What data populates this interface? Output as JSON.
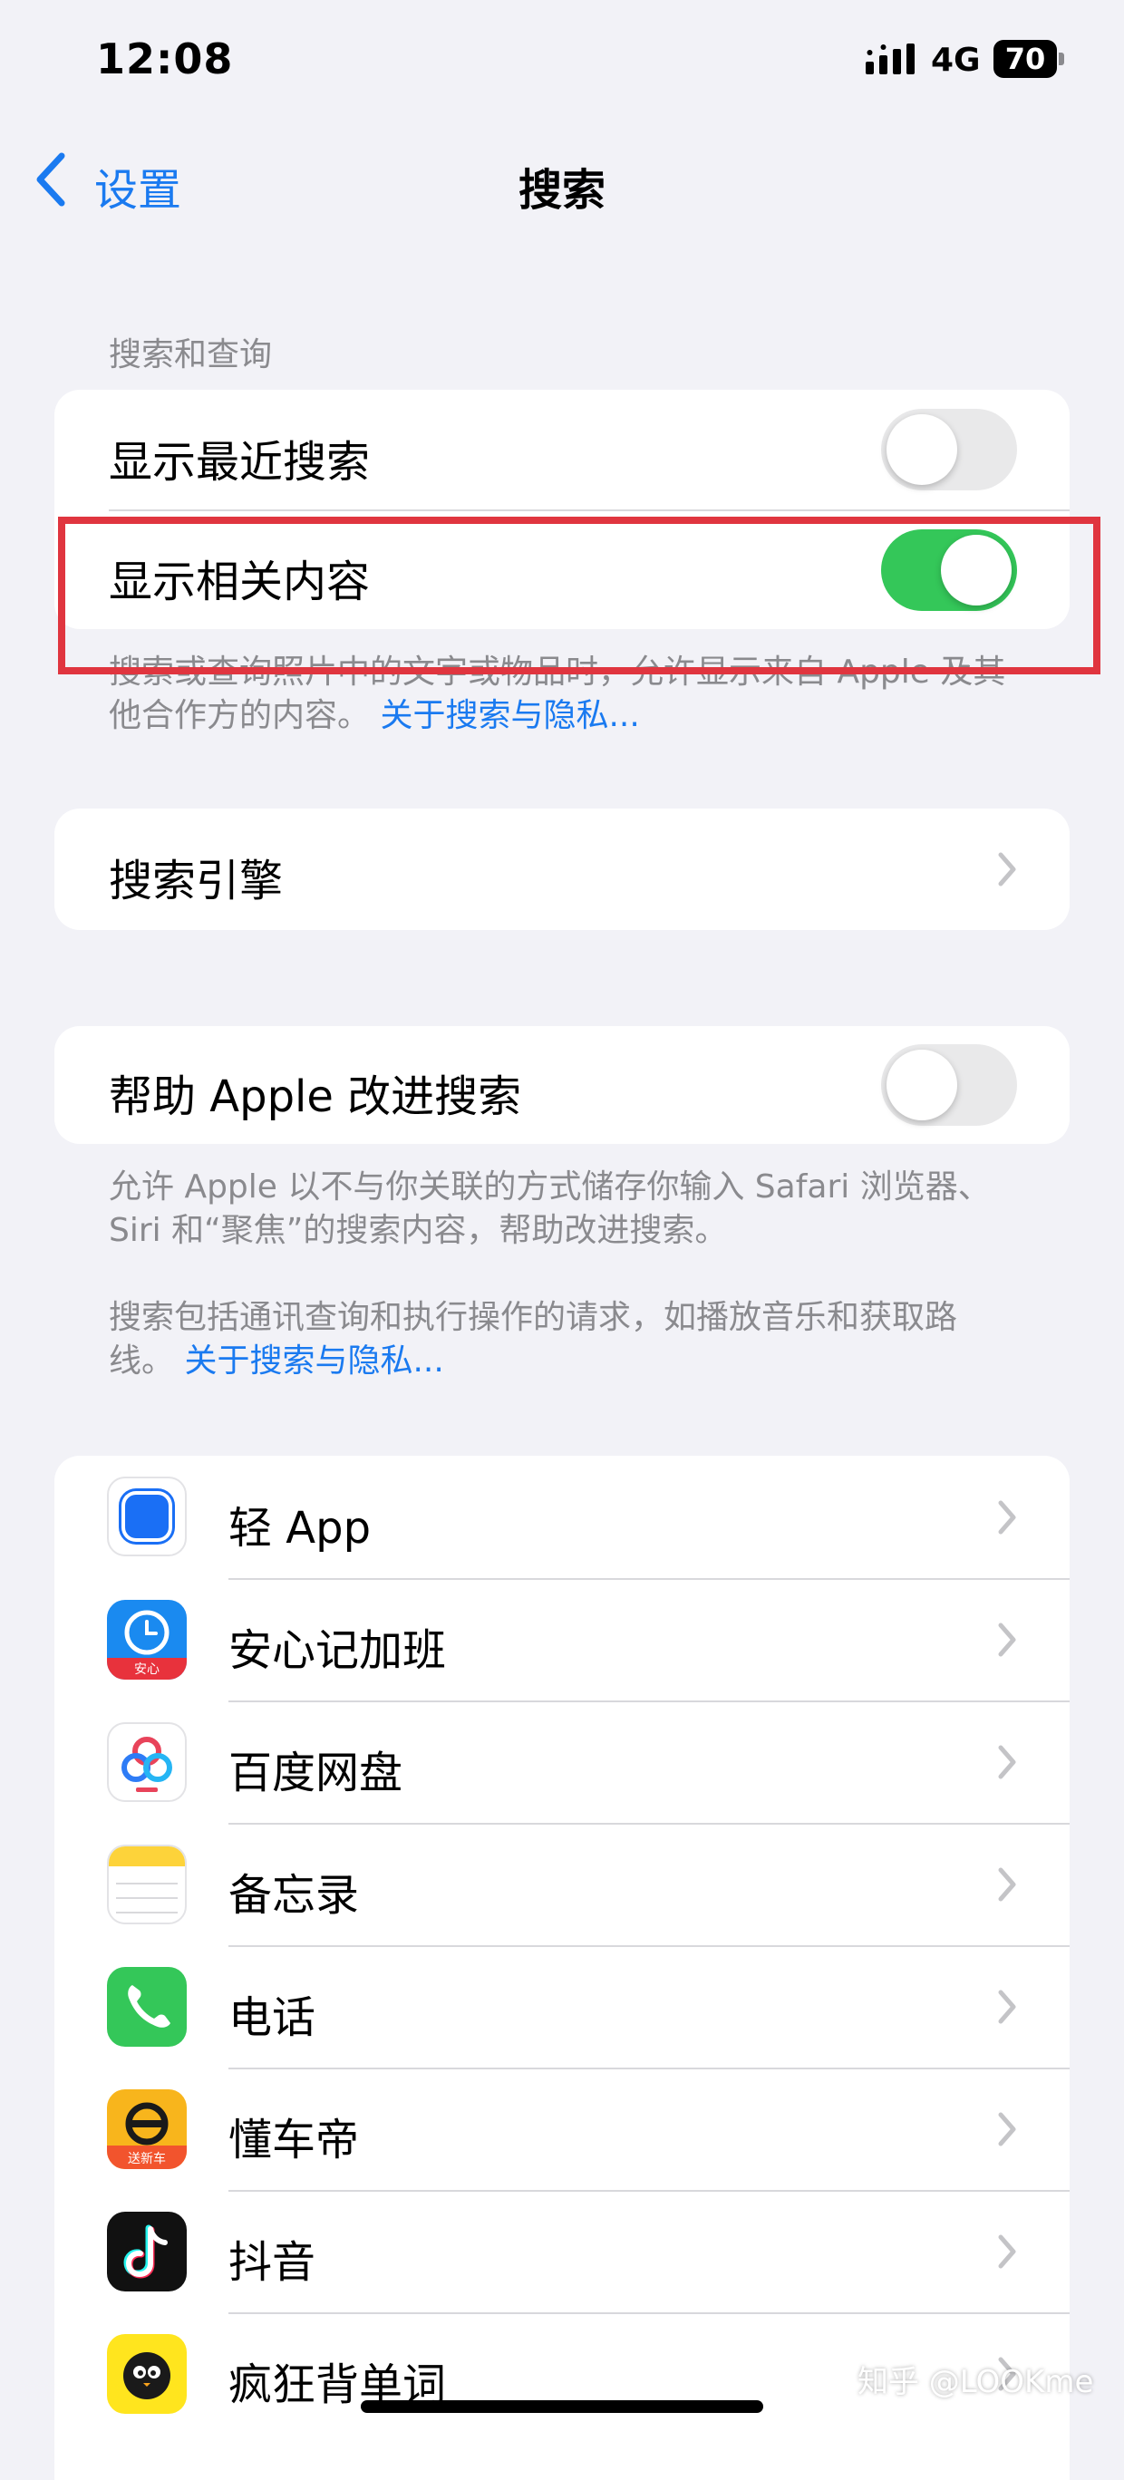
{
  "status_bar": {
    "time": "12:08",
    "network": "4G",
    "battery": "70"
  },
  "nav": {
    "back_label": "设置",
    "title": "搜索"
  },
  "search_section": {
    "header": "搜索和查询",
    "show_recent": {
      "label": "显示最近搜索",
      "enabled": false
    },
    "show_related": {
      "label": "显示相关内容",
      "enabled": true
    },
    "footer_text": "搜索或查询照片中的文字或物品时，允许显示来自 Apple 及其他合作方的内容。",
    "footer_link": "关于搜索与隐私..."
  },
  "search_engine": {
    "label": "搜索引擎"
  },
  "improve": {
    "label": "帮助 Apple 改进搜索",
    "enabled": false,
    "footer_1": "允许 Apple 以不与你关联的方式储存你输入 Safari 浏览器、Siri 和“聚焦”的搜索内容，帮助改进搜索。",
    "footer_2": "搜索包括通讯查询和执行操作的请求，如播放音乐和获取路线。",
    "footer_link": "关于搜索与隐私..."
  },
  "apps": [
    {
      "name": "轻 App",
      "icon": "light-app-icon"
    },
    {
      "name": "安心记加班",
      "icon": "overtime-clock-icon",
      "badge": "安心"
    },
    {
      "name": "百度网盘",
      "icon": "baidu-netdisk-icon"
    },
    {
      "name": "备忘录",
      "icon": "notes-icon"
    },
    {
      "name": "电话",
      "icon": "phone-icon"
    },
    {
      "name": "懂车帝",
      "icon": "dongchedi-icon",
      "badge": "送新车"
    },
    {
      "name": "抖音",
      "icon": "douyin-icon"
    },
    {
      "name": "疯狂背单词",
      "icon": "vocabulary-app-icon"
    }
  ],
  "watermark": "知乎 @LOOKme",
  "colors": {
    "accent": "#1a7af0",
    "toggle_on": "#34c759",
    "highlight": "#e0353f"
  }
}
